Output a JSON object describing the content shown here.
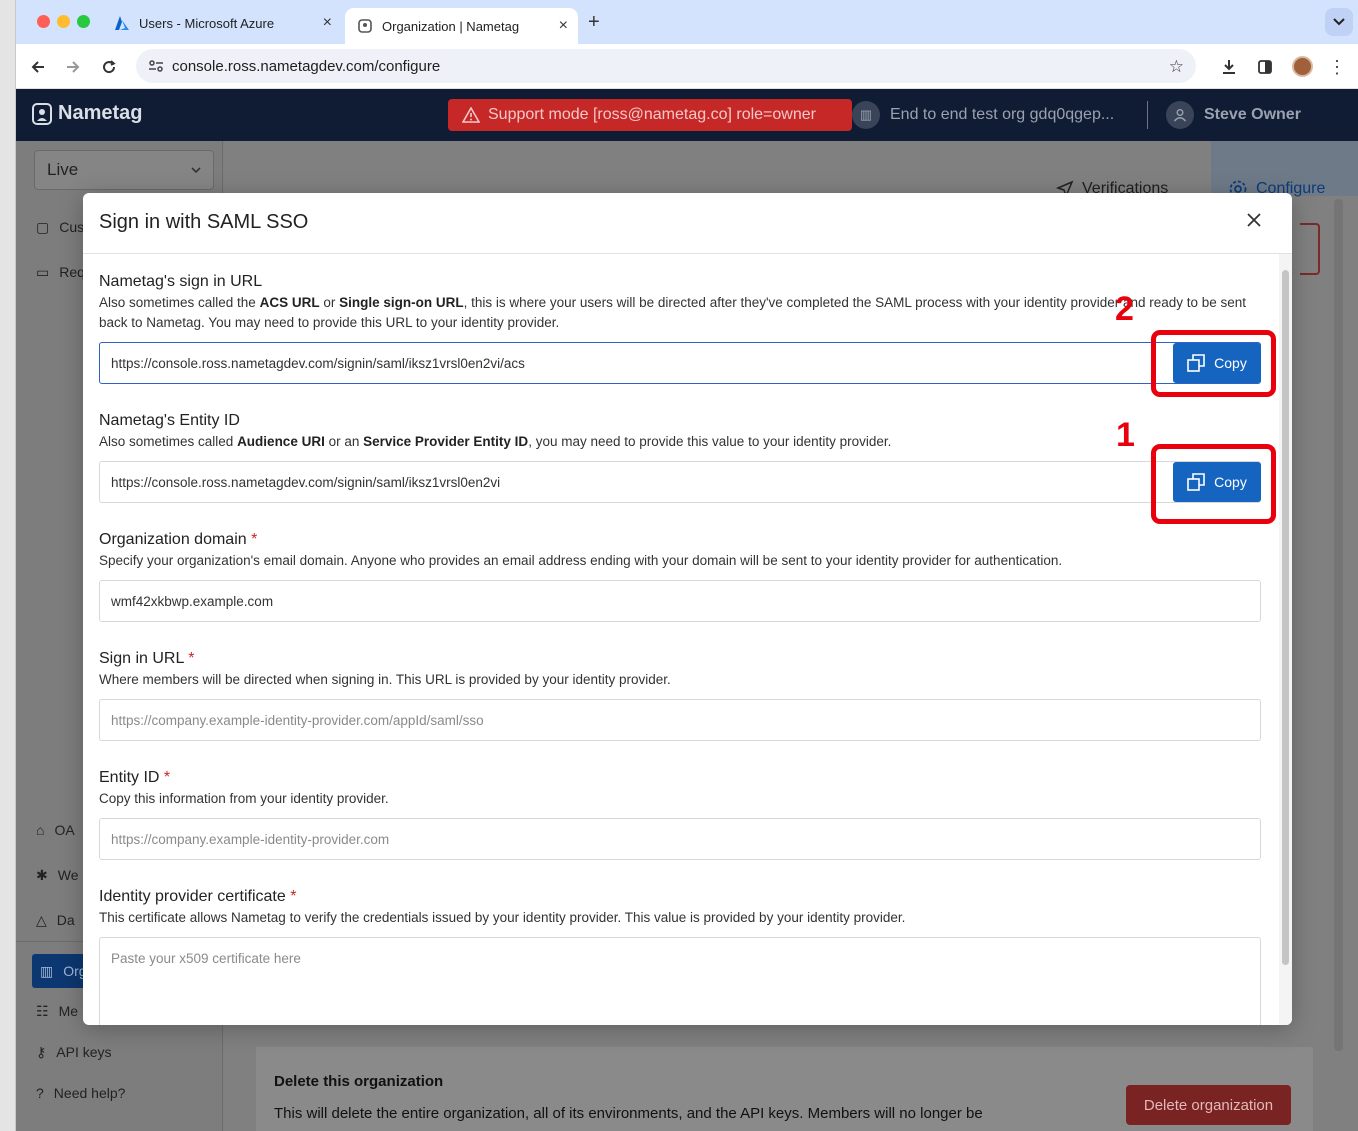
{
  "browser": {
    "tabs": [
      {
        "title": "Users - Microsoft Azure"
      },
      {
        "title": "Organization | Nametag"
      }
    ],
    "url": "console.ross.nametagdev.com/configure"
  },
  "app": {
    "logo": "Nametag",
    "support_banner": "Support mode [ross@nametag.co] role=owner",
    "org_name": "End to end test org gdq0qgep...",
    "user_name": "Steve Owner",
    "env_select": "Live",
    "nav": {
      "verifications": "Verifications",
      "configure": "Configure"
    },
    "sidebar_top": [
      "Cus",
      "Req"
    ],
    "sidebar_bottom": [
      "OA",
      "We",
      "Da",
      "Org",
      "Me",
      "API keys",
      "Need help?"
    ],
    "delete_section": {
      "title": "Delete this organization",
      "text": "This will delete the entire organization, all of its environments, and the API keys. Members will no longer be",
      "button": "Delete organization"
    }
  },
  "modal": {
    "title": "Sign in with SAML SSO",
    "acs": {
      "label": "Nametag's sign in URL",
      "desc_1": "Also sometimes called the ",
      "desc_b1": "ACS URL",
      "desc_2": " or ",
      "desc_b2": "Single sign-on URL",
      "desc_3": ", this is where your users will be directed after they've completed the SAML process with your identity provider and ready to be sent back to Nametag. You may need to provide this URL to your identity provider.",
      "value": "https://console.ross.nametagdev.com/signin/saml/iksz1vrsl0en2vi/acs",
      "copy": "Copy"
    },
    "entity": {
      "label": "Nametag's Entity ID",
      "desc_1": "Also sometimes called ",
      "desc_b1": "Audience URI",
      "desc_2": " or an ",
      "desc_b2": "Service Provider Entity ID",
      "desc_3": ", you may need to provide this value to your identity provider.",
      "value": "https://console.ross.nametagdev.com/signin/saml/iksz1vrsl0en2vi",
      "copy": "Copy"
    },
    "domain": {
      "label": "Organization domain",
      "required": "*",
      "desc": "Specify your organization's email domain. Anyone who provides an email address ending with your domain will be sent to your identity provider for authentication.",
      "value": "wmf42xkbwp.example.com"
    },
    "signin_url": {
      "label": "Sign in URL",
      "required": "*",
      "desc": "Where members will be directed when signing in. This URL is provided by your identity provider.",
      "placeholder": "https://company.example-identity-provider.com/appId/saml/sso"
    },
    "entity_id": {
      "label": "Entity ID",
      "required": "*",
      "desc": "Copy this information from your identity provider.",
      "placeholder": "https://company.example-identity-provider.com"
    },
    "certificate": {
      "label": "Identity provider certificate",
      "required": "*",
      "desc": "This certificate allows Nametag to verify the credentials issued by your identity provider. This value is provided by your identity provider.",
      "placeholder": "Paste your x509 certificate here"
    }
  },
  "annotations": {
    "first": "1",
    "second": "2",
    "color": "#e8000d"
  },
  "colors": {
    "primary": "#1565c0",
    "header": "#101c33",
    "danger": "#c62828"
  }
}
